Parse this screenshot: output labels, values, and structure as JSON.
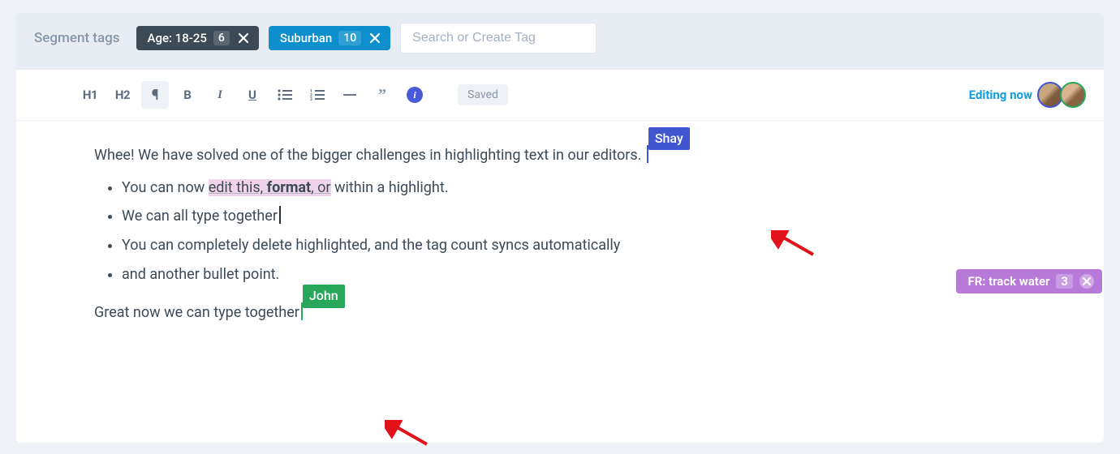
{
  "tagbar": {
    "label": "Segment tags",
    "tags": [
      {
        "label": "Age: 18-25",
        "count": "6",
        "style": "dark"
      },
      {
        "label": "Suburban",
        "count": "10",
        "style": "blue"
      }
    ],
    "search_placeholder": "Search or Create Tag"
  },
  "toolbar": {
    "h1": "H1",
    "h2": "H2",
    "bold": "B",
    "italic": "I",
    "underline": "U",
    "info": "i",
    "status": "Saved",
    "editing_now": "Editing now"
  },
  "collaborators": {
    "shay": "Shay",
    "john": "John"
  },
  "content": {
    "p1": "Whee! We have solved one of the bigger challenges in highlighting text in our editors. ",
    "li1_a": "You can now ",
    "li1_hl1": "edit this, ",
    "li1_hl_bold": "format",
    "li1_hl2": ", or",
    "li1_b": " within a highlight.",
    "li2": "We can all type together",
    "li3": "You can completely delete highlighted, and the tag count syncs automatically",
    "li4": "and another bullet point.",
    "p2": "Great now we can type together"
  },
  "side_tag": {
    "label": "FR: track water",
    "count": "3"
  }
}
